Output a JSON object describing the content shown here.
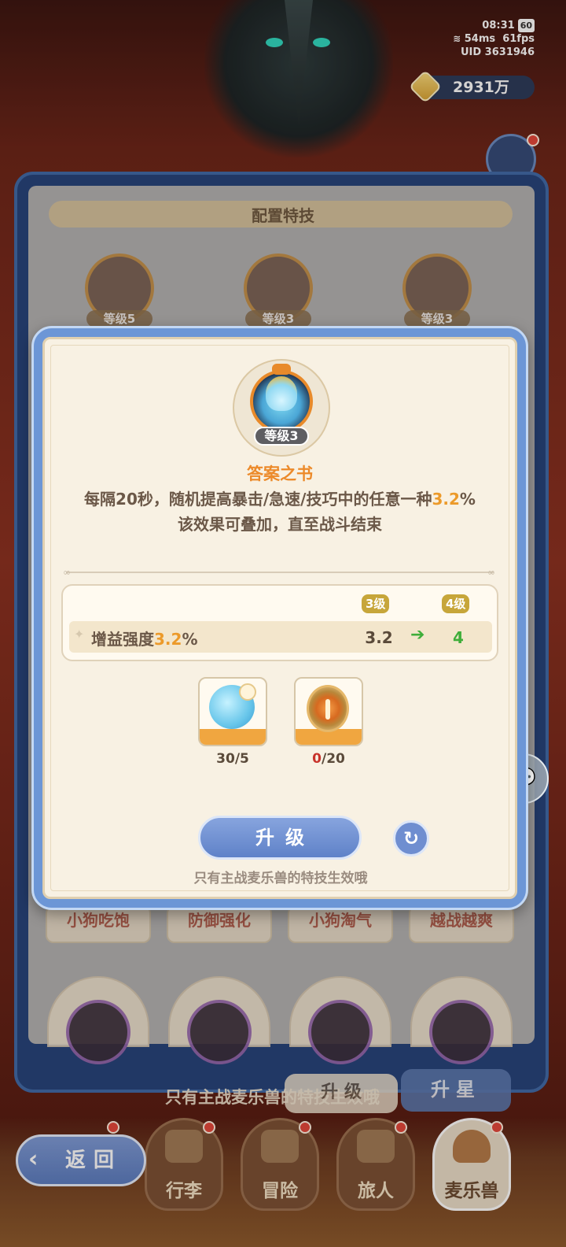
{
  "status_bar": {
    "time": "08:31",
    "battery": "60",
    "ping": "54ms",
    "fps": "61fps",
    "uid": "UID 3631946"
  },
  "currency": {
    "amount": "2931万",
    "icon": "gold-coin-icon"
  },
  "background_panel": {
    "title": "配置特技",
    "equipped_levels": [
      "等级5",
      "等级3",
      "等级3"
    ],
    "skill_chips": [
      "小狗吃饱",
      "防御强化",
      "小狗淘气",
      "越战越爽"
    ],
    "footer_hint": "只有主战麦乐兽的特技生效哦",
    "upgrade_label": "升 级",
    "star_label": "升星"
  },
  "bottom_nav": {
    "back_label": "返回",
    "tabs": [
      "行李",
      "冒险",
      "旅人",
      "麦乐兽"
    ],
    "active_tab": "麦乐兽"
  },
  "modal": {
    "skill_level": "等级3",
    "skill_name": "答案之书",
    "desc_line1_prefix": "每隔20秒，随机提高暴击/急速/技巧中的任意一种",
    "desc_line1_value": "3.2",
    "desc_line1_suffix": "%",
    "desc_line2": "该效果可叠加，直至战斗结束",
    "current_level_tag": "3级",
    "next_level_tag": "4级",
    "stat_label_prefix": "增益强度",
    "stat_label_value": "3.2",
    "stat_label_suffix": "%",
    "stat_current": "3.2",
    "stat_next": "4",
    "materials": [
      {
        "name": "slime",
        "owned": "30",
        "required": "/5"
      },
      {
        "name": "medal",
        "owned": "0",
        "required": "/20"
      }
    ],
    "upgrade_label": "升级",
    "hint": "只有主战麦乐兽的特技生效哦"
  },
  "colors": {
    "accent_orange": "#ec9a2a",
    "upgrade_green": "#3fae3a",
    "insufficient_red": "#c8322a",
    "button_blue": "#6f8ed0"
  }
}
